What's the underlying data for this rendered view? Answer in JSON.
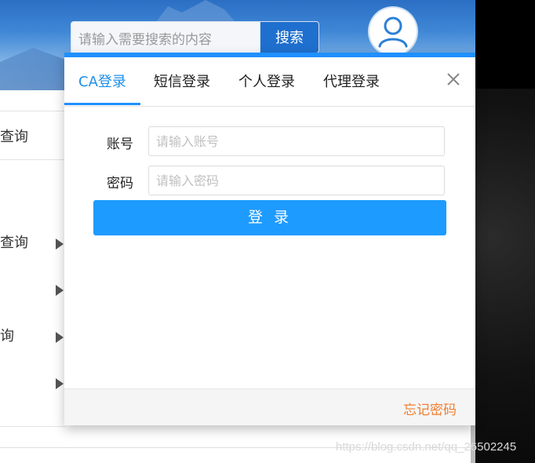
{
  "header": {
    "search_placeholder": "请输入需要搜索的内容",
    "search_button": "搜索"
  },
  "sidebar": {
    "items": [
      {
        "label": "查询"
      },
      {
        "label": "查询"
      },
      {
        "label": "询"
      }
    ]
  },
  "modal": {
    "tabs": [
      {
        "label": "CA登录",
        "active": true
      },
      {
        "label": "短信登录"
      },
      {
        "label": "个人登录"
      },
      {
        "label": "代理登录"
      }
    ],
    "account_label": "账号",
    "account_placeholder": "请输入账号",
    "password_label": "密码",
    "password_placeholder": "请输入密码",
    "login_button": "登 录",
    "forgot_password": "忘记密码"
  },
  "watermark": "https://blog.csdn.net/qq_26502245",
  "colors": {
    "accent": "#1e90ff",
    "forgot": "#f07f30",
    "search_button": "#1f6fcf"
  },
  "icons": [
    "user-avatar-icon",
    "close-icon",
    "triangle-right-icon"
  ]
}
